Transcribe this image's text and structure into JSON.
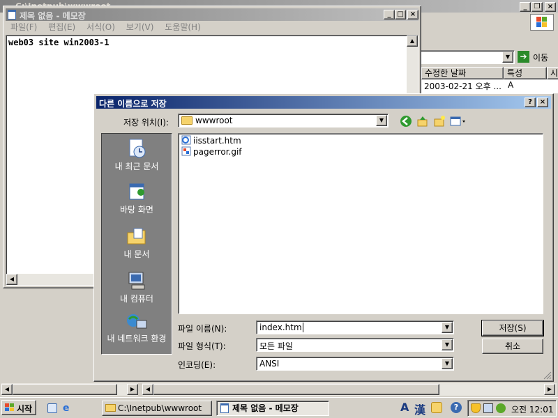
{
  "explorer": {
    "title": "C:\\Inetpub\\wwwroot",
    "go_label": "이동",
    "columns": [
      "수정한 날짜",
      "특성",
      "시"
    ],
    "row": {
      "date": "2003-02-21 오후 ...",
      "attr": "A"
    }
  },
  "notepad": {
    "title": "제목 없음 - 메모장",
    "menu": [
      "파일(F)",
      "편집(E)",
      "서식(O)",
      "보기(V)",
      "도움말(H)"
    ],
    "content": "web03 site win2003-1"
  },
  "dialog": {
    "title": "다른 이름으로 저장",
    "help": "?",
    "close": "×",
    "save_in_label": "저장 위치(I):",
    "save_in_value": "wwwroot",
    "places": [
      {
        "label": "내 최근 문서",
        "icon": "recent-documents-icon"
      },
      {
        "label": "바탕 화면",
        "icon": "desktop-icon"
      },
      {
        "label": "내 문서",
        "icon": "my-documents-icon"
      },
      {
        "label": "내 컴퓨터",
        "icon": "my-computer-icon"
      },
      {
        "label": "내 네트워크 환경",
        "icon": "network-places-icon"
      }
    ],
    "files": [
      {
        "name": "iisstart.htm",
        "icon": "html-file-icon"
      },
      {
        "name": "pagerror.gif",
        "icon": "gif-file-icon"
      }
    ],
    "filename_label": "파일 이름(N):",
    "filename_value": "index.htm",
    "filetype_label": "파일 형식(T):",
    "filetype_value": "모든 파일",
    "encoding_label": "인코딩(E):",
    "encoding_value": "ANSI",
    "save_button": "저장(S)",
    "cancel_button": "취소"
  },
  "taskbar": {
    "start": "시작",
    "tasks": [
      {
        "label": "C:\\Inetpub\\wwwroot",
        "icon": "folder-icon"
      },
      {
        "label": "제목 없음 - 메모장",
        "icon": "notepad-icon"
      }
    ],
    "ime_a": "A",
    "ime_han": "漢",
    "clock": "오전 12:01"
  },
  "colors": {
    "titlebar_active": "#0a246a",
    "titlebar_inactive": "#808080",
    "desktop_bg": "#d4d0c8"
  }
}
